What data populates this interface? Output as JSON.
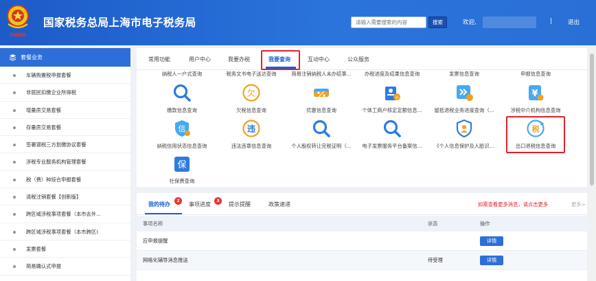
{
  "header": {
    "site_title": "国家税务总局上海市电子税务局",
    "search_placeholder": "请输入需要搜索的内容",
    "search_button": "搜索",
    "welcome": "欢迎,",
    "separator": "|",
    "logout": "退出",
    "brand_color": "#2b74dc"
  },
  "sidebar": {
    "header": "套餐业务",
    "header_icon": "layers-icon",
    "items": [
      {
        "label": "车辆购置税申报套餐"
      },
      {
        "label": "非居民扣缴企业所得税"
      },
      {
        "label": "增量房交易套餐"
      },
      {
        "label": "存量房交易套餐"
      },
      {
        "label": "签署银税三方划缴协议套餐"
      },
      {
        "label": "涉税专业服务机构管理套餐"
      },
      {
        "label": "税（费）种综合申报套餐"
      },
      {
        "label": "清税注销套餐【创新版】"
      },
      {
        "label": "跨区域涉税事项套餐（本市去外..."
      },
      {
        "label": "跨区域涉税事项套餐（本市跨区)"
      },
      {
        "label": "发票套餐"
      },
      {
        "label": "简易确认式申报"
      }
    ]
  },
  "services": {
    "tabs": [
      {
        "label": "常用功能"
      },
      {
        "label": "用户中心"
      },
      {
        "label": "我要办税"
      },
      {
        "label": "我要查询"
      },
      {
        "label": "互动中心"
      },
      {
        "label": "公众服务"
      }
    ],
    "active_tab": "我要查询",
    "top_row": [
      {
        "label": "纳税人一户式查询"
      },
      {
        "label": "税务文书电子送达查询"
      },
      {
        "label": "简易注销纳税人未办结事..."
      },
      {
        "label": "办税进度及结果信息查询"
      },
      {
        "label": "发票信息查询"
      },
      {
        "label": "申报信息查询"
      }
    ],
    "row2": [
      {
        "label": "缴款信息查询",
        "icon": "magnifier-icon"
      },
      {
        "label": "欠税信息查询",
        "icon": "qian-tax-icon",
        "glyph": "欠"
      },
      {
        "label": "优惠信息查询",
        "icon": "coupon-icon"
      },
      {
        "label": "个体工商户核定定额信息...",
        "icon": "user-document-icon"
      },
      {
        "label": "留抵退税业务进度查询（...",
        "icon": "refund-progress-icon"
      },
      {
        "label": "涉税中介机构信息查询",
        "icon": "agency-icon",
        "glyph": "¥"
      }
    ],
    "row3": [
      {
        "label": "纳税信用状态信息查询",
        "icon": "credit-icon",
        "glyph": "信"
      },
      {
        "label": "违法违章信息查询",
        "icon": "violation-icon",
        "glyph": "违"
      },
      {
        "label": "个人股权转让完税证明（...",
        "icon": "magnifier-icon"
      },
      {
        "label": "电子发票服务平台备案信...",
        "icon": "magnifier-icon"
      },
      {
        "label": "《个人信息保护及人脸识...",
        "icon": "privacy-icon"
      },
      {
        "label": "出口退税信息查询",
        "icon": "export-refund-icon",
        "glyph": "税"
      }
    ],
    "row4": [
      {
        "label": "社保费查询",
        "icon": "social-security-icon",
        "glyph": "保"
      }
    ]
  },
  "todo": {
    "tabs": [
      {
        "label": "我的待办",
        "badge": "2"
      },
      {
        "label": "事项进度",
        "badge": "3"
      },
      {
        "label": "提示提醒"
      },
      {
        "label": "政策速递"
      }
    ],
    "more_notice": "如需查看更多消息，请点击更多",
    "more_link": "更多>",
    "columns": [
      "事项名称",
      "状态",
      "操作"
    ],
    "rows": [
      {
        "name": "应申报提醒",
        "status": "",
        "action": "详情"
      },
      {
        "name": "网格化辅导消息推送",
        "status": "待受理",
        "action": "详情"
      }
    ]
  }
}
